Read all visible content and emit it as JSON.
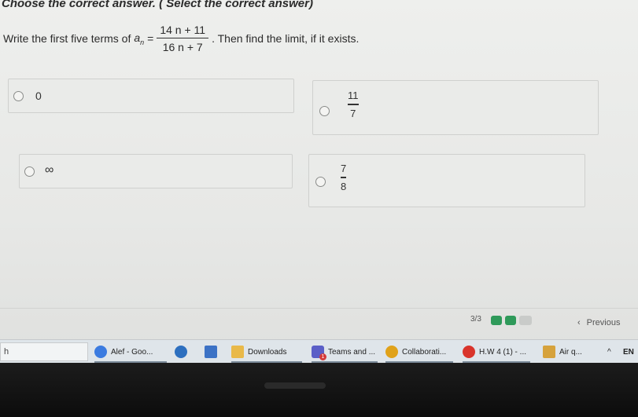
{
  "header": {
    "title": "Choose the correct answer. ( Select the correct answer)"
  },
  "question": {
    "prefix": "Write the first five terms of",
    "symbol": "a",
    "subscript": "n",
    "equals": "=",
    "numerator": "14 n + 11",
    "denominator": "16 n + 7",
    "suffix": ". Then find the limit, if it exists."
  },
  "options": [
    {
      "text": "0"
    },
    {
      "numerator": "11",
      "denominator": "7"
    },
    {
      "text": "∞"
    },
    {
      "numerator": "7",
      "denominator": "8"
    }
  ],
  "footer": {
    "pager": "3/3",
    "previous_label": "Previous",
    "previous_icon": "chevron-left-icon",
    "dot_colors": [
      "#2f9a5a",
      "#2f9a5a",
      "#c9cbc9"
    ]
  },
  "taskbar": {
    "search_text": "h",
    "items": [
      {
        "label": "Alef - Goo...",
        "icon": "chrome-icon",
        "color": "#3b7be0"
      },
      {
        "label": "",
        "icon": "weather-icon",
        "color": "#2d6fbf"
      },
      {
        "label": "",
        "icon": "calendar-icon",
        "color": "#3c72c5"
      },
      {
        "label": "Downloads",
        "icon": "folder-icon",
        "color": "#e9b949"
      },
      {
        "label": "Teams and ...",
        "icon": "teams-icon",
        "color": "#5b5fc7",
        "badge": "1"
      },
      {
        "label": "Collaborati...",
        "icon": "zoom-icon",
        "color": "#e0a21a"
      },
      {
        "label": "H.W 4 (1) - ...",
        "icon": "pdf-icon",
        "color": "#d9342b"
      },
      {
        "label": "Air q...",
        "icon": "air-quality-icon",
        "color": "#d6a23c"
      }
    ],
    "tray_chevron": "^",
    "lang": "EN"
  }
}
